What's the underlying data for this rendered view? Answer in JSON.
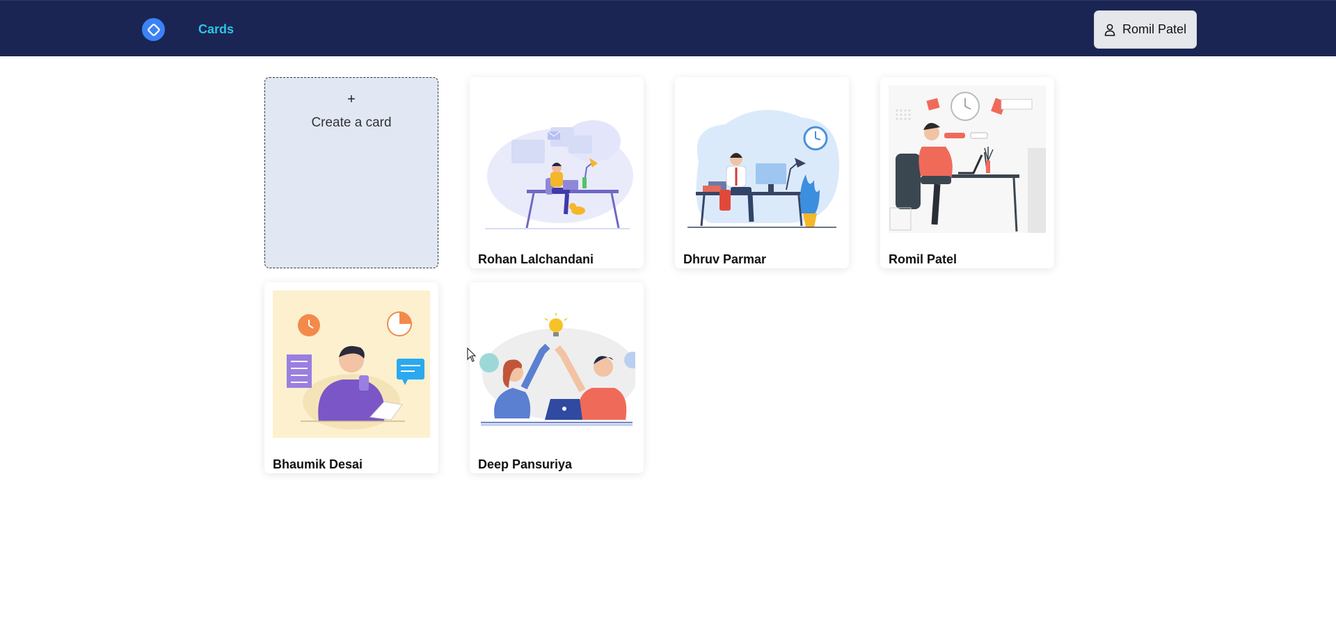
{
  "header": {
    "logo_icon": "diamond-logo-icon",
    "nav_link": "Cards",
    "user_icon": "user-icon",
    "user_name": "Romil Patel"
  },
  "create_card": {
    "plus": "+",
    "label": "Create a card"
  },
  "cards": [
    {
      "name": "Rohan Lalchandani",
      "illustration": "person-at-desk-with-laptop-and-cat"
    },
    {
      "name": "Dhruv Parmar",
      "illustration": "man-working-at-computer-desk"
    },
    {
      "name": "Romil Patel",
      "illustration": "man-typing-on-laptop"
    },
    {
      "name": "Bhaumik Desai",
      "illustration": "man-with-phone-and-tasks"
    },
    {
      "name": "Deep Pansuriya",
      "illustration": "two-people-high-five"
    }
  ],
  "colors": {
    "navbar": "#1a2553",
    "accent": "#2ec4e6",
    "logo": "#3b82f6",
    "create_card_bg": "#e1e7f3"
  }
}
